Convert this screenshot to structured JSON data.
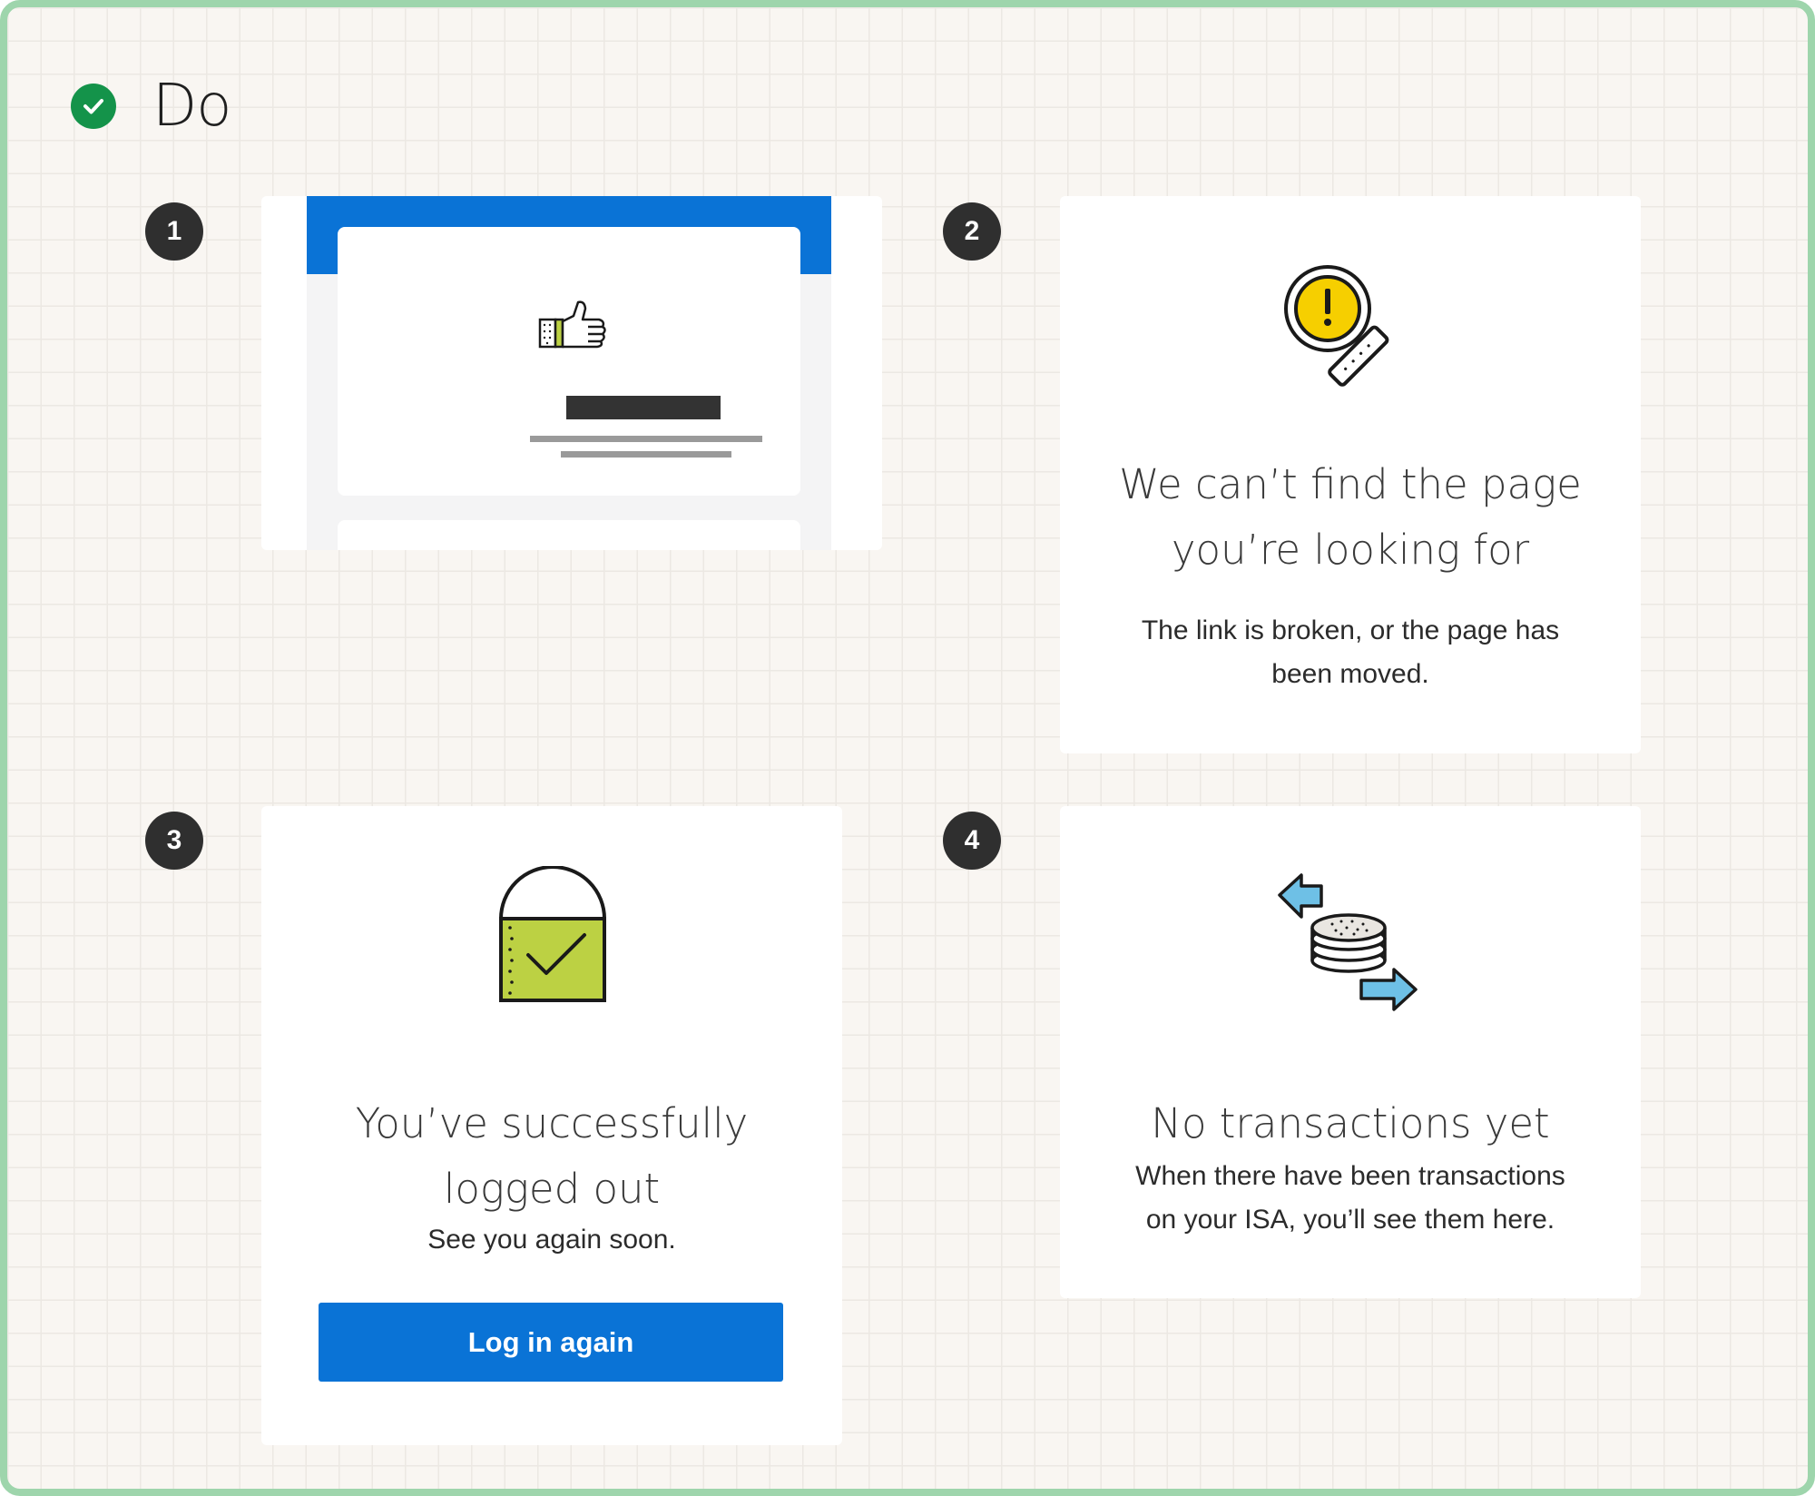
{
  "header": {
    "label": "Do",
    "icon": "check-circle-icon",
    "badge_color": "#14934a"
  },
  "examples": [
    {
      "number": "1",
      "illustration": "thumbs-up-icon"
    },
    {
      "number": "2",
      "illustration": "magnifier-warning-icon",
      "title_lines": [
        "We can’t find the page",
        "you’re looking for"
      ],
      "body_lines": [
        "The link is broken, or the page has",
        "been moved."
      ]
    },
    {
      "number": "3",
      "illustration": "padlock-check-icon",
      "title_lines": [
        "You’ve successfully",
        "logged out"
      ],
      "body_lines": [
        "See you again soon."
      ],
      "button_label": "Log in again"
    },
    {
      "number": "4",
      "illustration": "coins-transfer-icon",
      "title_lines": [
        "No transactions yet"
      ],
      "body_lines": [
        "When there have been transactions",
        "on your ISA, you’ll see them here."
      ]
    }
  ],
  "colors": {
    "primary": "#0a73d6",
    "frame_border": "#9ed5ac",
    "warning": "#f6cf00",
    "lime": "#bcd143",
    "arrow": "#6ec0e6"
  }
}
